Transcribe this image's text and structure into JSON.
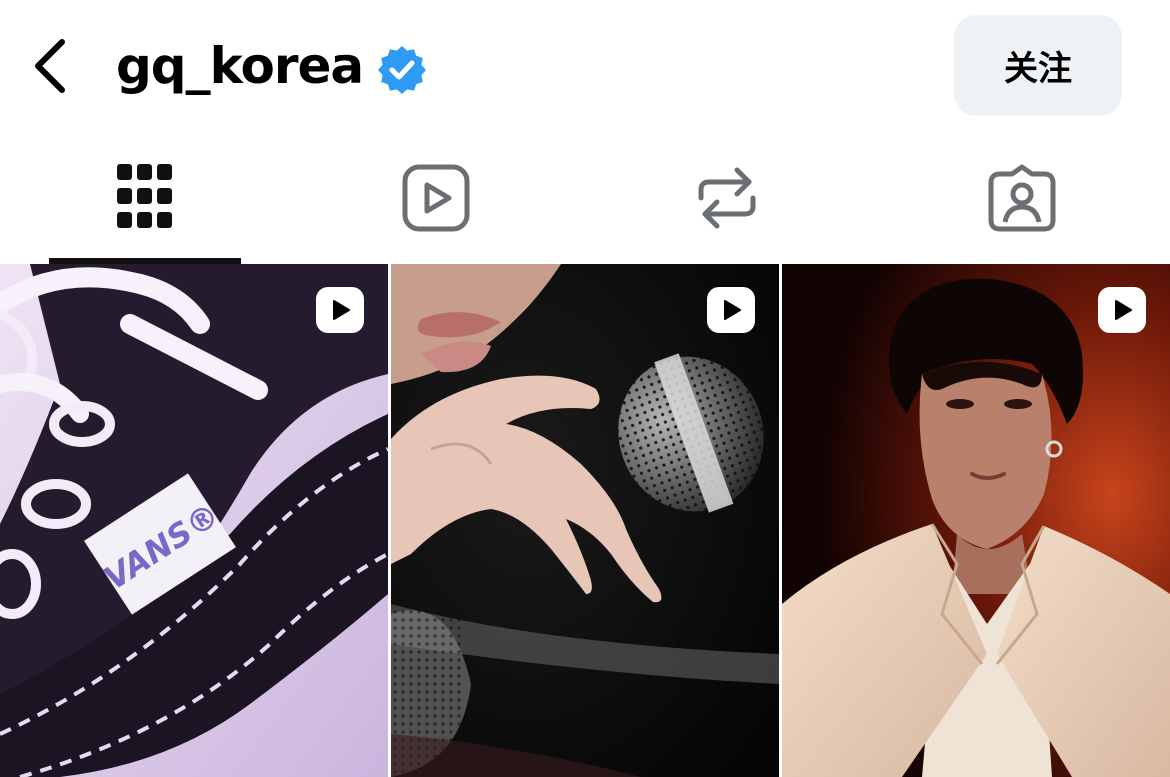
{
  "header": {
    "back_icon": "chevron-left-icon",
    "username": "gq_korea",
    "verified_icon": "verified-badge-icon",
    "verified_color": "#2f9bf5",
    "follow_label": "关注"
  },
  "tabs": [
    {
      "name": "posts",
      "icon": "grid-icon",
      "active": true
    },
    {
      "name": "reels",
      "icon": "reels-play-icon",
      "active": false
    },
    {
      "name": "reposts",
      "icon": "repost-icon",
      "active": false
    },
    {
      "name": "tagged",
      "icon": "tagged-person-icon",
      "active": false
    }
  ],
  "grid": {
    "items": [
      {
        "type": "reel",
        "badge_icon": "reel-play-icon",
        "brand_label": "VANS®"
      },
      {
        "type": "reel",
        "badge_icon": "reel-play-icon"
      },
      {
        "type": "reel",
        "badge_icon": "reel-play-icon"
      }
    ]
  }
}
